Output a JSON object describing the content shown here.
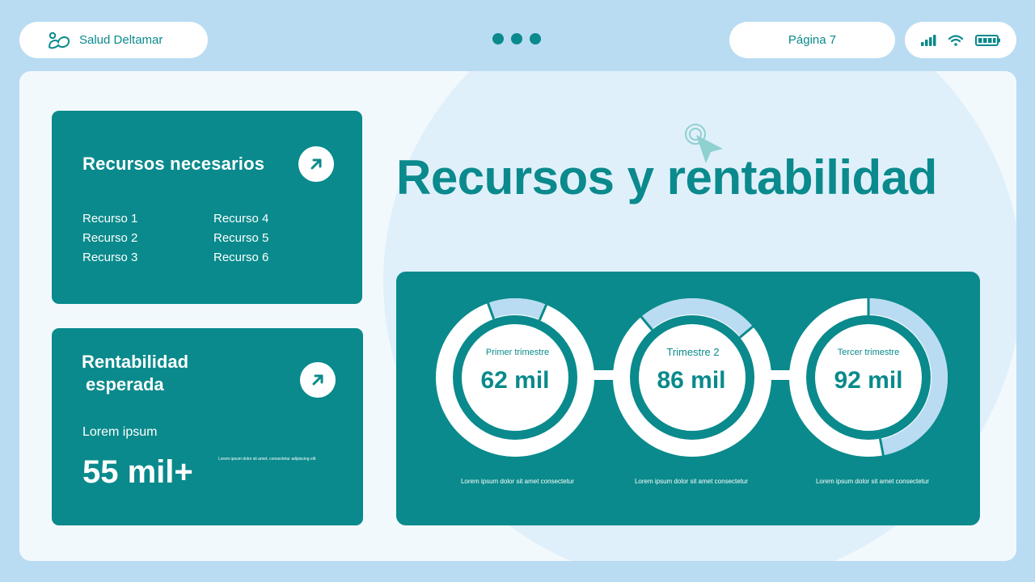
{
  "header": {
    "brand": "Salud Deltamar",
    "page_label": "Página 7",
    "status_icons": [
      "signal-icon",
      "wifi-icon",
      "battery-icon"
    ]
  },
  "colors": {
    "accent": "#0a8a8c",
    "light_accent": "#b9dcf2",
    "panel": "#f2f9fd"
  },
  "resources": {
    "title": "Recursos necesarios",
    "items": [
      "Recurso 1",
      "Recurso 2",
      "Recurso 3",
      "Recurso 4",
      "Recurso 5",
      "Recurso 6"
    ]
  },
  "profitability": {
    "title_line1": "Rentabilidad",
    "title_line2": "esperada",
    "subtitle": "Lorem ipsum",
    "value": "55 mil+",
    "note": "Lorem ipsum dolor sit amet, consectetur adipiscing elit"
  },
  "main_title": "Recursos y rentabilidad",
  "quarters": [
    {
      "label": "Primer trimestre",
      "value": "62 mil",
      "caption": "Lorem ipsum dolor sit amet consectetur"
    },
    {
      "label": "Trimestre 2",
      "value": "86 mil",
      "caption": "Lorem ipsum dolor sit amet consectetur"
    },
    {
      "label": "Tercer trimestre",
      "value": "92 mil",
      "caption": "Lorem ipsum dolor sit amet consectetur"
    }
  ],
  "chart_data": {
    "type": "pie",
    "categories": [
      "Primer trimestre",
      "Trimestre 2",
      "Tercer trimestre"
    ],
    "values": [
      62,
      86,
      92
    ],
    "ring_fraction": [
      0.12,
      0.25,
      0.47
    ]
  }
}
